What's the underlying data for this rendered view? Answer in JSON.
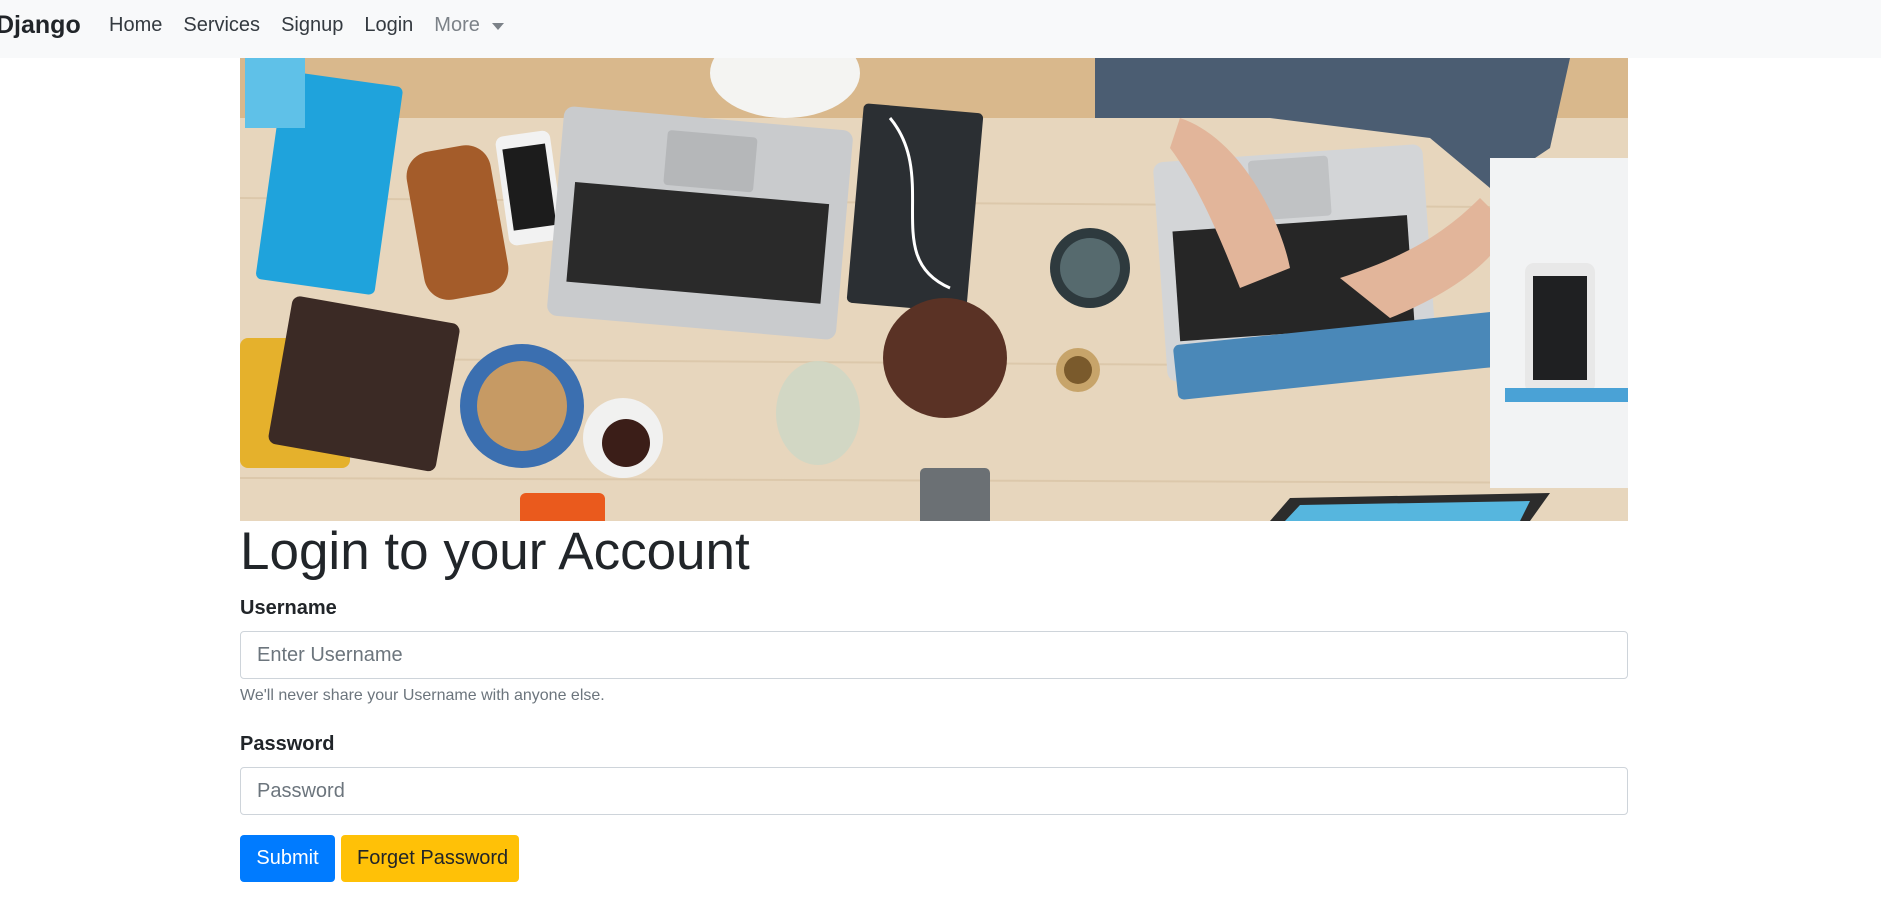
{
  "navbar": {
    "brand": "Django",
    "links": [
      "Home",
      "Services",
      "Signup",
      "Login"
    ],
    "more_label": "More"
  },
  "hero": {
    "description": "office-desk-photo"
  },
  "form": {
    "title": "Login to your Account",
    "username_label": "Username",
    "username_placeholder": "Enter Username",
    "username_help": "We'll never share your Username with anyone else.",
    "password_label": "Password",
    "password_placeholder": "Password",
    "submit_label": "Submit",
    "forget_label": "Forget Password"
  },
  "colors": {
    "navbar_bg": "#f8f9fa",
    "primary": "#007bff",
    "warning": "#ffc107"
  }
}
